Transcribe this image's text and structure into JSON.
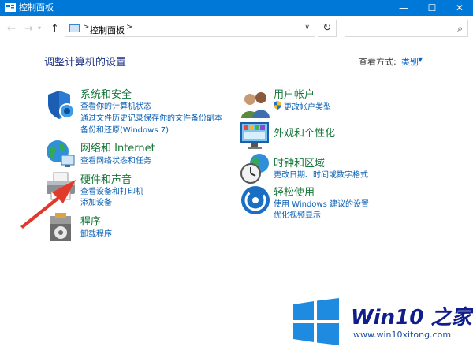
{
  "window": {
    "title": "控制面板",
    "minimize": "—",
    "maximize": "☐",
    "close": "✕"
  },
  "address_bar": {
    "back": "←",
    "forward": "→",
    "recent": "▾",
    "up": "↑",
    "separator": ">",
    "breadcrumb": "控制面板",
    "dropdown": "∨",
    "refresh": "↻",
    "search_placeholder": "",
    "search_icon": "⌕"
  },
  "main": {
    "heading": "调整计算机的设置",
    "view_by_label": "查看方式:",
    "view_by_value": "类别",
    "view_by_arrow": "▼"
  },
  "categories": {
    "system": {
      "title": "系统和安全",
      "links": [
        "查看你的计算机状态",
        "通过文件历史记录保存你的文件备份副本",
        "备份和还原(Windows 7)"
      ]
    },
    "network": {
      "title": "网络和 Internet",
      "links": [
        "查看网络状态和任务"
      ]
    },
    "hardware": {
      "title": "硬件和声音",
      "links": [
        "查看设备和打印机",
        "添加设备"
      ]
    },
    "programs": {
      "title": "程序",
      "links": [
        "卸载程序"
      ]
    },
    "user": {
      "title": "用户帐户",
      "links": [
        "更改帐户类型"
      ]
    },
    "appearance": {
      "title": "外观和个性化",
      "links": []
    },
    "clock": {
      "title": "时钟和区域",
      "links": [
        "更改日期、时间或数字格式"
      ]
    },
    "ease": {
      "title": "轻松使用",
      "links": [
        "使用 Windows 建议的设置",
        "优化视频显示"
      ]
    }
  },
  "watermark": {
    "brand": "Win10 之家",
    "url": "www.win10xitong.com"
  },
  "colors": {
    "titlebar": "#0078d7",
    "category_title": "#16763a",
    "link": "#0a5fb4",
    "heading": "#1e3287",
    "arrow": "#e23a2a"
  }
}
